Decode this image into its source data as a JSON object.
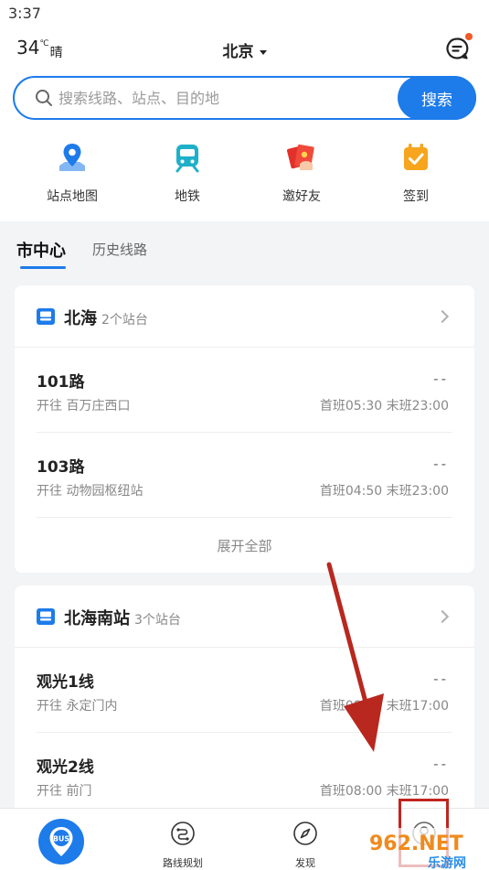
{
  "status_bar": {
    "time": "3:37"
  },
  "header": {
    "temperature": "34",
    "unit": "℃",
    "condition": "晴",
    "city": "北京"
  },
  "search": {
    "placeholder": "搜索线路、站点、目的地",
    "button": "搜索"
  },
  "quick_actions": [
    {
      "label": "站点地图",
      "icon": "map-pin-icon"
    },
    {
      "label": "地铁",
      "icon": "subway-icon"
    },
    {
      "label": "邀好友",
      "icon": "red-envelope-icon"
    },
    {
      "label": "签到",
      "icon": "calendar-check-icon"
    }
  ],
  "tabs": [
    {
      "label": "市中心",
      "active": true
    },
    {
      "label": "历史线路",
      "active": false
    }
  ],
  "stations": [
    {
      "name": "北海",
      "count": "2个站台",
      "routes": [
        {
          "name": "101路",
          "dest": "开往 百万庄西口",
          "eta": "--",
          "times": "首班05:30 末班23:00"
        },
        {
          "name": "103路",
          "dest": "开往 动物园枢纽站",
          "eta": "--",
          "times": "首班04:50 末班23:00"
        }
      ],
      "expand": "展开全部"
    },
    {
      "name": "北海南站",
      "count": "3个站台",
      "routes": [
        {
          "name": "观光1线",
          "dest": "开往 永定门内",
          "eta": "--",
          "times": "首班08:00 末班17:00"
        },
        {
          "name": "观光2线",
          "dest": "开往 前门",
          "eta": "--",
          "times": "首班08:00 末班17:00"
        }
      ]
    }
  ],
  "bottom_nav": [
    {
      "label": "",
      "icon": "bus-home-icon",
      "badge": "BUS"
    },
    {
      "label": "路线规划",
      "icon": "route-icon"
    },
    {
      "label": "发现",
      "icon": "compass-icon"
    },
    {
      "label": "",
      "icon": "profile-icon"
    }
  ],
  "watermark": {
    "text": "962.NET",
    "subtext": "乐游网"
  },
  "colors": {
    "accent": "#1d7bea",
    "annotation": "#c0251f",
    "notify": "#f05a28"
  }
}
